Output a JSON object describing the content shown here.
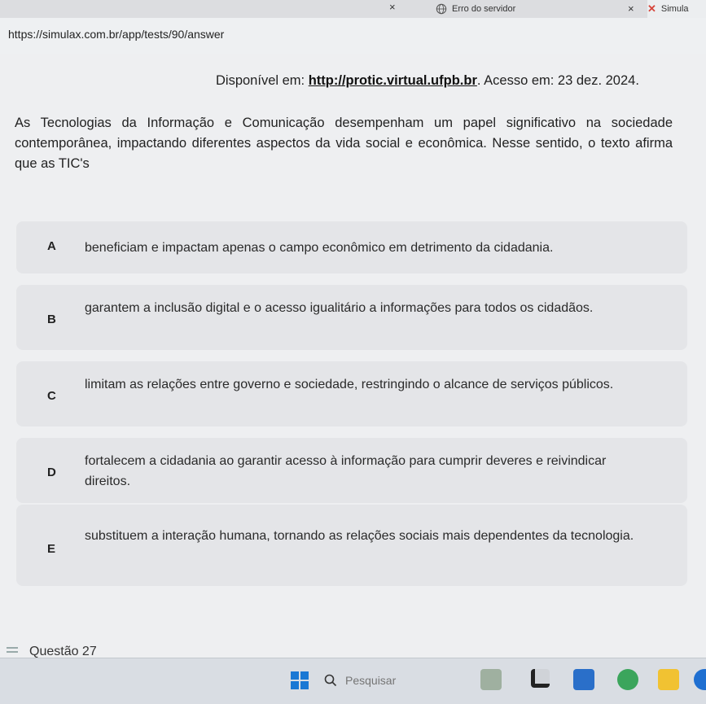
{
  "browser": {
    "tabs": [
      {
        "title": "Erro do servidor"
      },
      {
        "title": "Simula"
      }
    ],
    "url": "https://simulax.com.br/app/tests/90/answer"
  },
  "content": {
    "source_prefix": "Disponível em: ",
    "source_link": "http://protic.virtual.ufpb.br",
    "source_suffix": ". Acesso em: 23 dez. 2024.",
    "prompt": "As Tecnologias da Informação e Comunicação desempenham um papel significativo na sociedade contemporânea, impactando diferentes aspectos da vida social e econômica. Nesse sentido, o texto afirma que as TIC's",
    "options": [
      {
        "letter": "A",
        "text": "beneficiam e impactam apenas o campo econômico em detrimento da cidadania."
      },
      {
        "letter": "B",
        "text": "garantem a inclusão digital e o acesso igualitário a informações para todos os cidadãos."
      },
      {
        "letter": "C",
        "text": "limitam as relações entre governo e sociedade, restringindo o alcance de serviços públicos."
      },
      {
        "letter": "D",
        "text": "fortalecem a cidadania ao garantir acesso à informação para cumprir deveres e reivindicar direitos."
      },
      {
        "letter": "E",
        "text": "substituem a interação humana, tornando as relações sociais mais dependentes da tecnologia."
      }
    ],
    "next_question": "Questão 27"
  },
  "taskbar": {
    "search_placeholder": "Pesquisar"
  },
  "colors": {
    "windows_blue": "#1a78d4",
    "error_x": "#d6453b"
  }
}
